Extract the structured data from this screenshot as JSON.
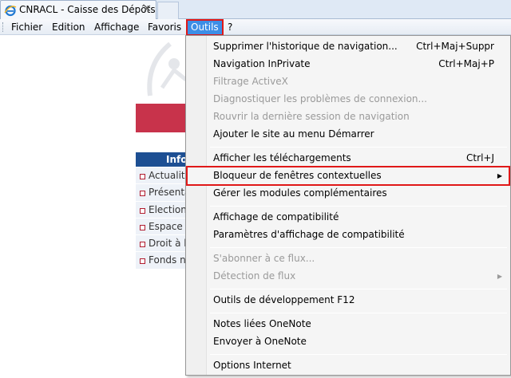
{
  "tab": {
    "title": "CNRACL - Caisse des Dépôts",
    "close": "✕"
  },
  "menubar": {
    "items": [
      "Fichier",
      "Edition",
      "Affichage",
      "Favoris",
      "Outils",
      "?"
    ]
  },
  "page": {
    "nav_header": "Info",
    "nav_items": [
      "Actualités",
      "Présentation",
      "Elections",
      "Espace p",
      "Droit à l'i",
      "Fonds na"
    ]
  },
  "dropdown": {
    "items": [
      {
        "label": "Supprimer l'historique de navigation...",
        "shortcut": "Ctrl+Maj+Suppr"
      },
      {
        "label": "Navigation InPrivate",
        "shortcut": "Ctrl+Maj+P"
      },
      {
        "label": "Filtrage ActiveX"
      },
      {
        "label": "Diagnostiquer les problèmes de connexion..."
      },
      {
        "label": "Rouvrir la dernière session de navigation"
      },
      {
        "label": "Ajouter le site au menu Démarrer"
      },
      {
        "label": "Afficher les téléchargements",
        "shortcut": "Ctrl+J"
      },
      {
        "label": "Bloqueur de fenêtres contextuelles"
      },
      {
        "label": "Gérer les modules complémentaires"
      },
      {
        "label": "Affichage de compatibilité"
      },
      {
        "label": "Paramètres d'affichage de compatibilité"
      },
      {
        "label": "S'abonner à ce flux..."
      },
      {
        "label": "Détection de flux"
      },
      {
        "label": "Outils de développement F12"
      },
      {
        "label": "Notes liées OneNote"
      },
      {
        "label": "Envoyer à OneNote"
      },
      {
        "label": "Options Internet"
      }
    ]
  },
  "colors": {
    "active_menu_bg": "#3d8ee6",
    "highlight_outline": "#e01818",
    "disabled_text": "#9a9a9a"
  }
}
